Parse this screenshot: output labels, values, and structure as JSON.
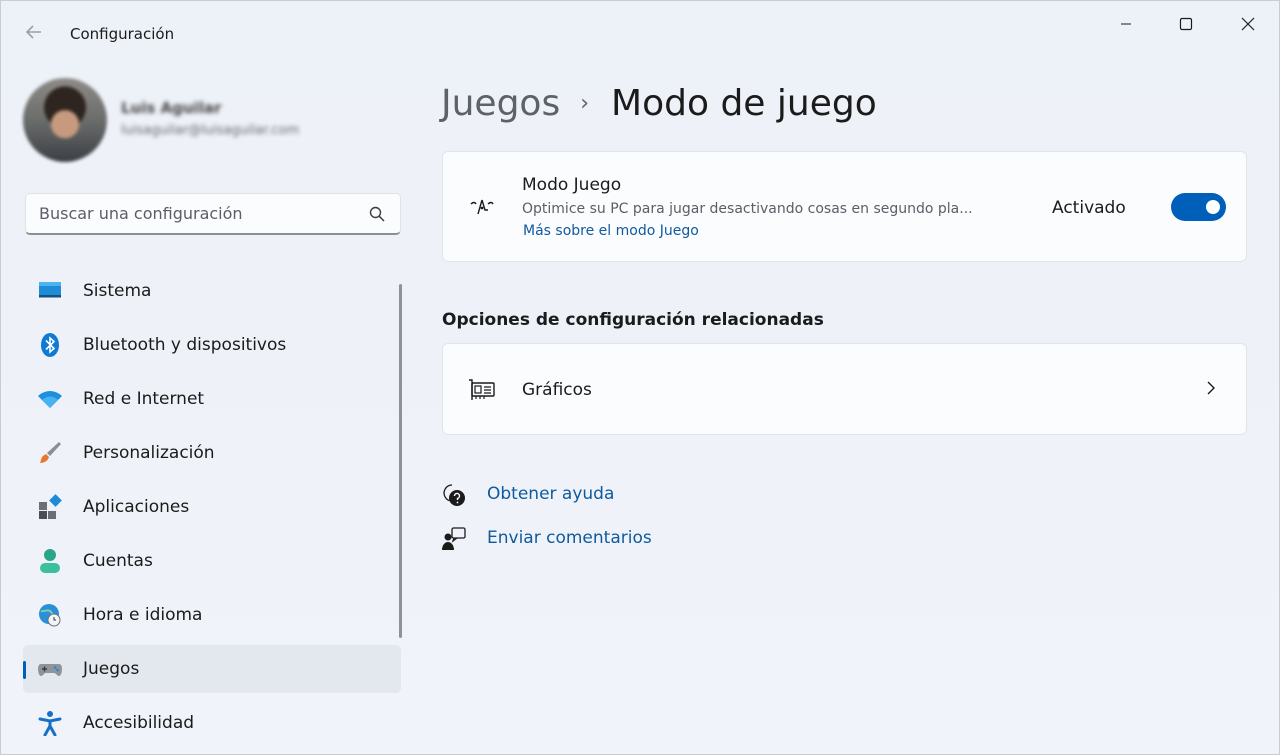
{
  "app": {
    "title": "Configuración",
    "back_icon": "back-arrow-icon"
  },
  "window_controls": [
    "minimize-icon",
    "maximize-icon",
    "close-icon"
  ],
  "profile": {
    "name": "Luis Aguilar",
    "email": "luisaguilar@luisaguilar.com"
  },
  "search": {
    "placeholder": "Buscar una configuración"
  },
  "sidebar": {
    "items": [
      {
        "label": "Sistema",
        "icon": "system-icon",
        "active": false
      },
      {
        "label": "Bluetooth y dispositivos",
        "icon": "bluetooth-icon",
        "active": false
      },
      {
        "label": "Red e Internet",
        "icon": "wifi-icon",
        "active": false
      },
      {
        "label": "Personalización",
        "icon": "brush-icon",
        "active": false
      },
      {
        "label": "Aplicaciones",
        "icon": "apps-icon",
        "active": false
      },
      {
        "label": "Cuentas",
        "icon": "account-icon",
        "active": false
      },
      {
        "label": "Hora e idioma",
        "icon": "clock-globe-icon",
        "active": false
      },
      {
        "label": "Juegos",
        "icon": "gamepad-icon",
        "active": true
      },
      {
        "label": "Accesibilidad",
        "icon": "accessibility-icon",
        "active": false
      }
    ]
  },
  "breadcrumb": {
    "parent": "Juegos",
    "separator": "›",
    "current": "Modo de juego"
  },
  "game_mode": {
    "title": "Modo Juego",
    "description": "Optimice su PC para jugar desactivando cosas en segundo pla...",
    "link": "Más sobre el modo Juego",
    "state_label": "Activado",
    "enabled": true,
    "icon": "game-mode-icon"
  },
  "related": {
    "heading": "Opciones de configuración relacionadas",
    "items": [
      {
        "label": "Gráficos",
        "icon": "graphics-card-icon"
      }
    ]
  },
  "help_links": [
    {
      "label": "Obtener ayuda",
      "icon": "help-chat-icon"
    },
    {
      "label": "Enviar comentarios",
      "icon": "feedback-icon"
    }
  ],
  "colors": {
    "accent": "#005fb8",
    "link": "#0f5a9e"
  }
}
